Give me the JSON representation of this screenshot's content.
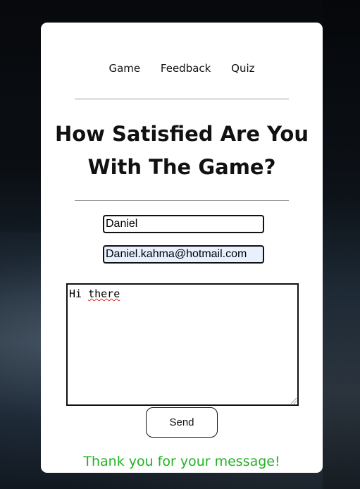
{
  "nav": {
    "items": [
      "Game",
      "Feedback",
      "Quiz"
    ]
  },
  "header": {
    "title_line1": "How Satisfied Are You",
    "title_line2": "With The Game?"
  },
  "form": {
    "name_value": "Daniel",
    "email_value": "Daniel.kahma@hotmail.com",
    "message_word1": "Hi",
    "message_word2": "there",
    "send_label": "Send"
  },
  "status": {
    "confirmation": "Thank you for your message!"
  },
  "colors": {
    "confirmation": "#22b222",
    "autofill_background": "#e8f0fe",
    "spellcheck_underline": "#e03030"
  }
}
